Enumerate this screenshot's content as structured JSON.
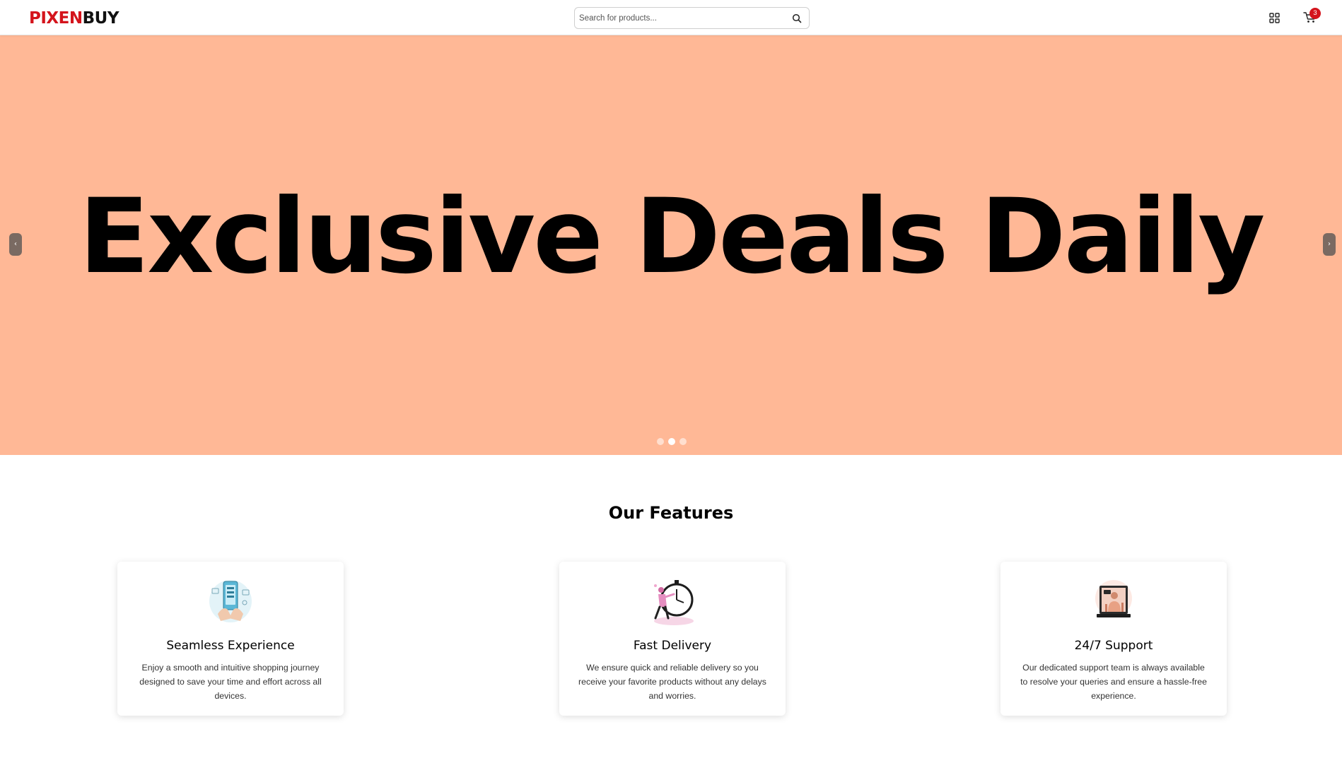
{
  "header": {
    "logo_part1": "PIXEN",
    "logo_part2": "BUY",
    "search_placeholder": "Search for products...",
    "cart_count": "3",
    "icons": [
      "search-icon",
      "grid-icon",
      "cart-icon"
    ]
  },
  "hero": {
    "title": "Exclusive Deals Daily",
    "prev_label": "‹",
    "next_label": "›",
    "background": "#ffb896",
    "slide_count": 3,
    "active_slide": 2
  },
  "features": {
    "title": "Our Features",
    "cards": [
      {
        "title": "Seamless Experience",
        "description": "Enjoy a smooth and intuitive shopping journey designed to save your time and effort across all devices.",
        "icon": "phone-shopping-illustration"
      },
      {
        "title": "Fast Delivery",
        "description": "We ensure quick and reliable delivery so you receive your favorite products without any delays and worries.",
        "icon": "clock-runner-illustration"
      },
      {
        "title": "24/7 Support",
        "description": "Our dedicated support team is always available to resolve your queries and ensure a hassle-free experience.",
        "icon": "support-laptop-illustration"
      }
    ]
  },
  "colors": {
    "brand_red": "#d4141c",
    "hero_bg": "#ffb896"
  }
}
